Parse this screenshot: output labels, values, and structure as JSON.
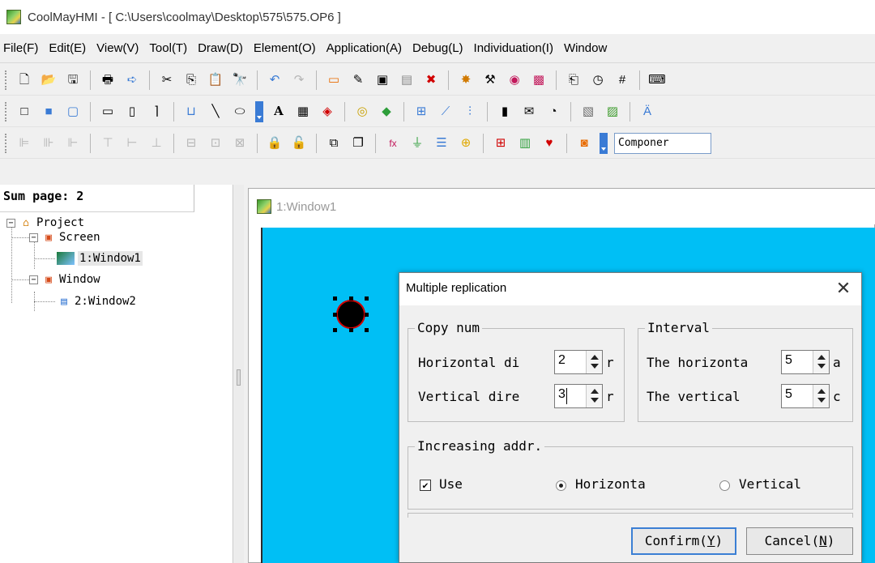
{
  "window": {
    "title": "CoolMayHMI - [ C:\\Users\\coolmay\\Desktop\\575\\575.OP6 ]"
  },
  "menu": [
    "File(F)",
    "Edit(E)",
    "View(V)",
    "Tool(T)",
    "Draw(D)",
    "Element(O)",
    "Application(A)",
    "Debug(L)",
    "Individuation(I)",
    "Window"
  ],
  "toolbars": {
    "row1": [
      "new-file-icon",
      "open-folder-icon",
      "save-icon",
      "print-icon",
      "export-icon",
      "cut-icon",
      "copy-icon",
      "paste-icon",
      "find-icon",
      "undo-icon",
      "redo-icon",
      "rectangle-tool-icon",
      "edit-properties-icon",
      "screen-icon",
      "window-icon",
      "delete-icon",
      "settings-icon",
      "tool-icon",
      "image-library-icon",
      "function-icon",
      "page-icon",
      "clock-icon",
      "grid-icon",
      "keyboard-icon"
    ],
    "row2": [
      "frame-rect-icon",
      "rect-icon",
      "blue-rect-icon",
      "horizontal-bar-icon",
      "vertical-bar-icon",
      "corner-line-icon",
      "scale-icon",
      "line-icon",
      "ellipse-icon",
      "text-icon",
      "numeric-display-icon",
      "alarm-icon",
      "button-icon",
      "lamp-icon",
      "trend-chart-icon",
      "line-chart-icon",
      "bar-chart-icon",
      "meter-icon",
      "message-icon",
      "timer-icon",
      "picture-icon",
      "photo-icon",
      "font-icon"
    ],
    "row3": [
      "align-left-icon",
      "align-center-icon",
      "align-right-icon",
      "align-top-icon",
      "align-middle-icon",
      "align-bottom-icon",
      "same-width-icon",
      "same-height-icon",
      "same-size-icon",
      "lock-icon",
      "unlock-icon",
      "group-icon",
      "ungroup-icon",
      "formula-icon",
      "plug-icon",
      "list-icon",
      "warning-icon",
      "report-icon",
      "status-icon",
      "heart-icon",
      "record-icon"
    ],
    "component_label": "Componer"
  },
  "left_pane": {
    "sum_page": "Sum page: 2",
    "tree": {
      "root": "Project",
      "screen": "Screen",
      "screen_item": "1:Window1",
      "window": "Window",
      "window_item": "2:Window2"
    }
  },
  "mdi": {
    "title": "1:Window1"
  },
  "dialog": {
    "title": "Multiple replication",
    "close": "✕",
    "copy_num": {
      "legend": "Copy num",
      "horizontal_label": "Horizontal di",
      "horizontal_tail": "r",
      "horizontal_value": "2",
      "vertical_label": "Vertical dire",
      "vertical_tail": "r",
      "vertical_value": "3"
    },
    "interval": {
      "legend": "Interval",
      "horizontal_label": "The horizonta",
      "horizontal_tail": "a",
      "horizontal_value": "5",
      "vertical_label": "The vertical",
      "vertical_tail": "c",
      "vertical_value": "5"
    },
    "increasing": {
      "legend": "Increasing addr.",
      "use_label": "Use",
      "use_checked": true,
      "mark": "✔",
      "horizontal_label": "Horizonta",
      "vertical_label": "Vertical",
      "selected": "horizontal"
    },
    "buttons": {
      "confirm_text": "Confirm(",
      "confirm_key": "Y",
      "cancel_text": "Cancel(",
      "cancel_key": "N",
      "close_paren": ")"
    }
  },
  "colors": {
    "canvas": "#00bff5",
    "accent": "#3b7fd4"
  }
}
